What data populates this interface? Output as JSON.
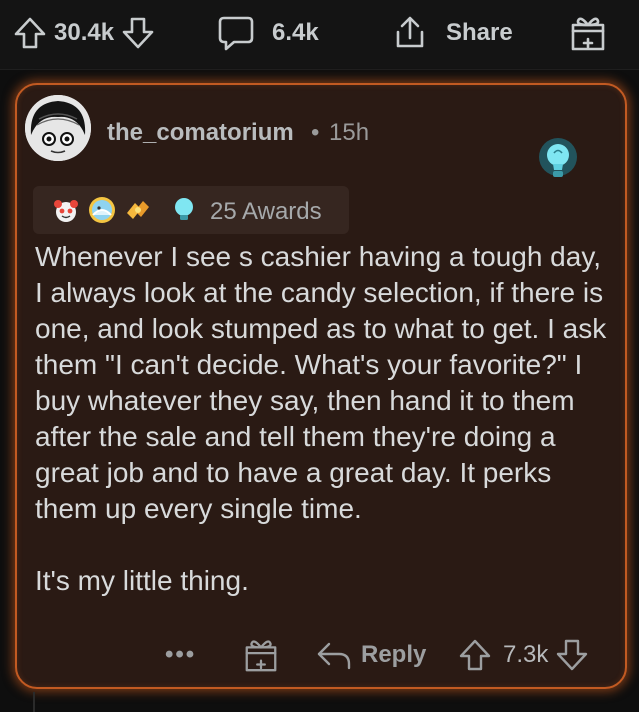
{
  "topbar": {
    "upvotes": "30.4k",
    "comments": "6.4k",
    "share_label": "Share"
  },
  "comment": {
    "username": "the_comatorium",
    "separator": "•",
    "age": "15h",
    "awards_label": "25 Awards",
    "award_icons": [
      "wholesome-award-icon",
      "sun-award-icon",
      "helpful-hands-award-icon",
      "lightbulb-award-icon"
    ],
    "flair_icon": "lightbulb-flair-icon",
    "body": "Whenever I see s cashier having a tough day, I always look at the candy selection, if there is one, and look stumped as to what to get. I ask them \"I can't decide. What's your favorite?\" I buy whatever they say, then hand it to them after the sale and tell them they're doing a great job and to have a great day. It perks them up every single time.\n\nIt's my little thing.",
    "actions": {
      "more_label": "•••",
      "reply_label": "Reply",
      "votes": "7.3k"
    }
  },
  "colors": {
    "card_background": "#2a1a14",
    "card_glow": "#c25a22",
    "page_background": "#0e0e0e"
  }
}
